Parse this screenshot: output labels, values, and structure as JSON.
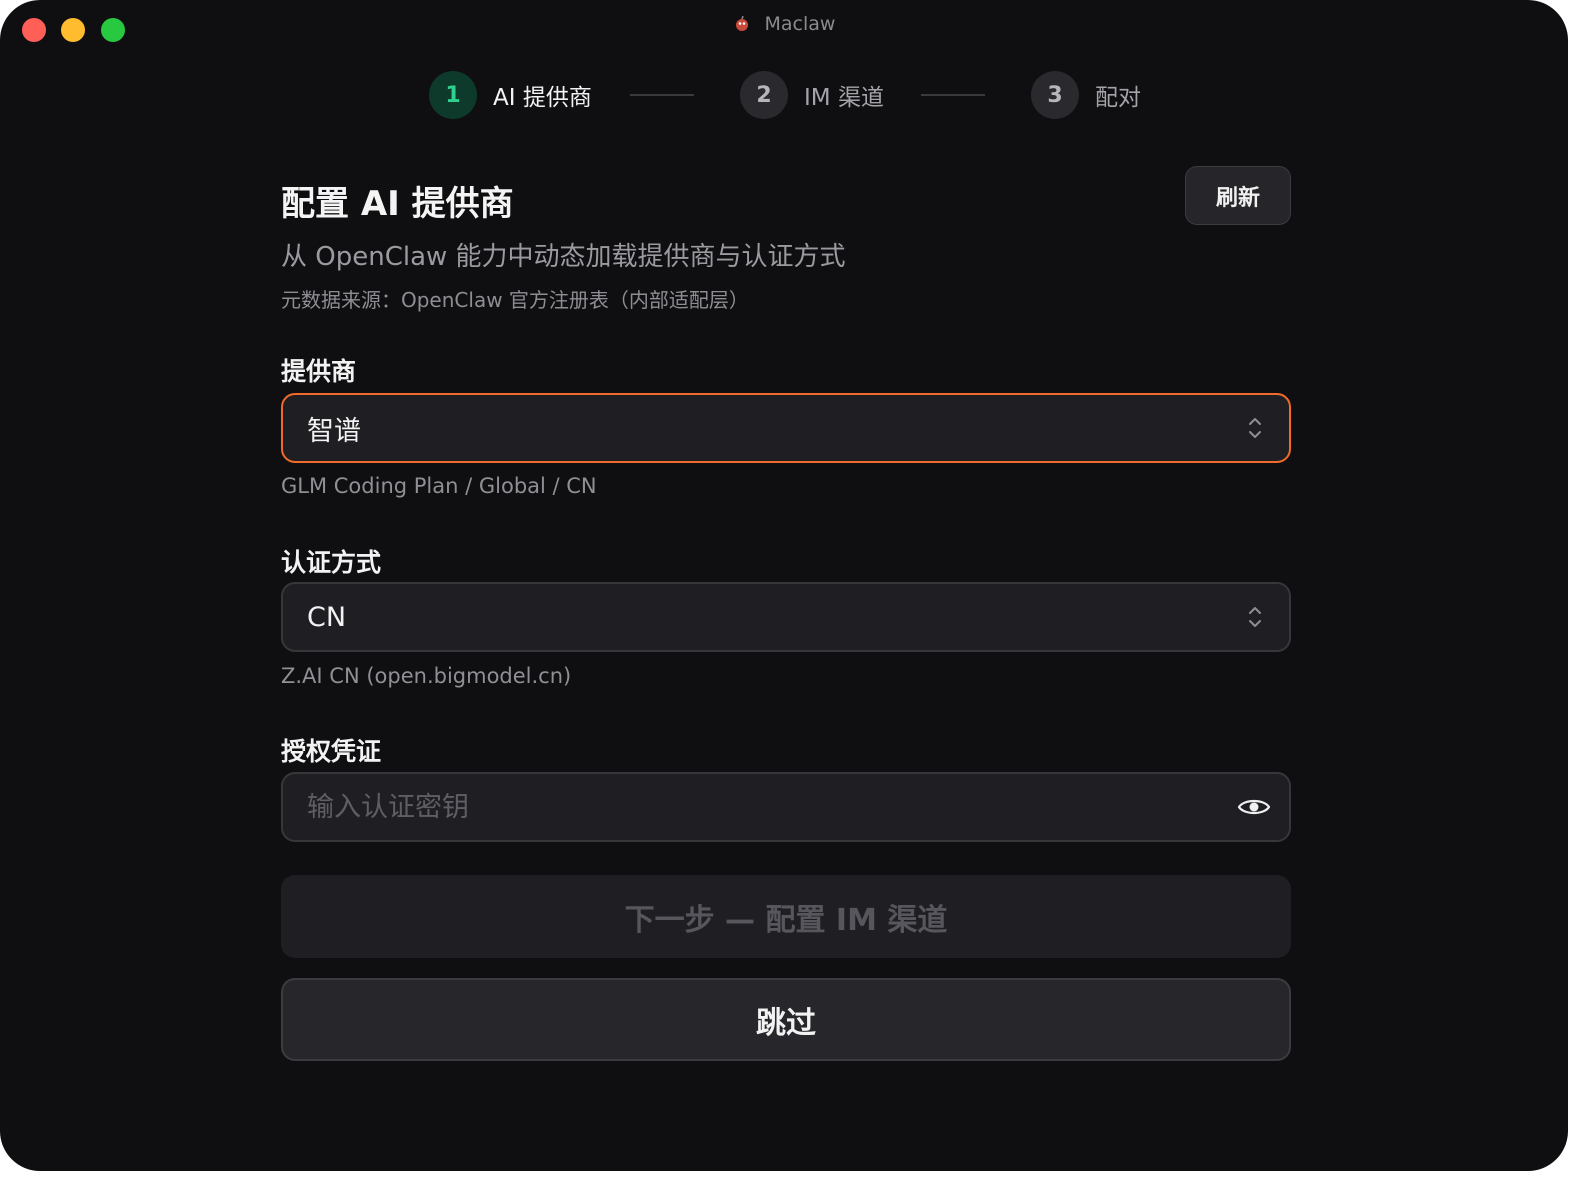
{
  "window": {
    "title": "Maclaw",
    "colors": {
      "close": "#ff5f57",
      "minimize": "#febc2e",
      "zoom": "#28c840",
      "background": "#0f0f11"
    }
  },
  "stepper": {
    "steps": [
      {
        "number": "1",
        "label": "AI 提供商",
        "state": "active"
      },
      {
        "number": "2",
        "label": "IM 渠道",
        "state": "inactive"
      },
      {
        "number": "3",
        "label": "配对",
        "state": "inactive"
      }
    ],
    "active_color": "#2fd08f"
  },
  "header": {
    "title": "配置 AI 提供商",
    "refresh_label": "刷新",
    "subtitle": "从 OpenClaw 能力中动态加载提供商与认证方式",
    "meta": "元数据来源：OpenClaw 官方注册表（内部适配层）"
  },
  "form": {
    "provider": {
      "label": "提供商",
      "value": "智谱",
      "hint": "GLM Coding Plan / Global / CN",
      "icon": "chevron-up-down-icon",
      "focus_color": "#f06a2a"
    },
    "auth_method": {
      "label": "认证方式",
      "value": "CN",
      "hint": "Z.AI CN (open.bigmodel.cn)",
      "icon": "chevron-up-down-icon"
    },
    "credential": {
      "label": "授权凭证",
      "value": "",
      "placeholder": "输入认证密钥",
      "icon": "eye-icon"
    }
  },
  "actions": {
    "next_label": "下一步 — 配置 IM 渠道",
    "next_disabled": true,
    "skip_label": "跳过"
  }
}
